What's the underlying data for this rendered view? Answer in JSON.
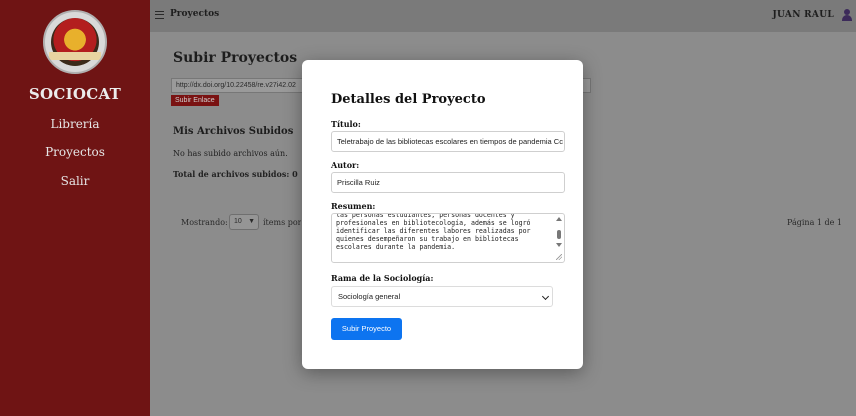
{
  "colors": {
    "sidebar": "#6f1414",
    "primary_button": "#0d74f0",
    "link_button": "#7a1212"
  },
  "sidebar": {
    "brand": "SOCIOCAT",
    "logo_icon": "university-seal-logo",
    "items": [
      {
        "label": "Librería"
      },
      {
        "label": "Proyectos"
      },
      {
        "label": "Salir"
      }
    ]
  },
  "topbar": {
    "menu_icon": "hamburger-icon",
    "title": "Proyectos",
    "user_name": "JUAN RAUL",
    "user_icon": "user-icon"
  },
  "main": {
    "heading": "Subir Proyectos",
    "link_value": "http://dx.doi.org/10.22458/re.v27i42.02",
    "link_button": "Subir Enlace",
    "files_heading": "Mis Archivos Subidos",
    "no_files": "No has subido archivos aún.",
    "total_files": "Total de archivos subidos: 0",
    "showing_label": "Mostrando:",
    "per_page_value": "10",
    "items_per_page": "ítems por página",
    "page_info": "Página 1 de 1"
  },
  "modal": {
    "title": "Detalles del Proyecto",
    "title_label": "Título:",
    "title_value": "Teletrabajo de las bibliotecas escolares en tiempos de pandemia Cc",
    "author_label": "Autor:",
    "author_value": "Priscilla Ruiz",
    "summary_label": "Resumen:",
    "summary_value": "las personas estudiantes, personas docentes y\nprofesionales en bibliotecología, además se logró\nidentificar las diferentes labores realizadas por\nquienes desempeñaron su trabajo en bibliotecas\nescolares durante la pandemia.",
    "branch_label": "Rama de la Sociología:",
    "branch_value": "Sociología general",
    "submit_label": "Subir Proyecto"
  }
}
